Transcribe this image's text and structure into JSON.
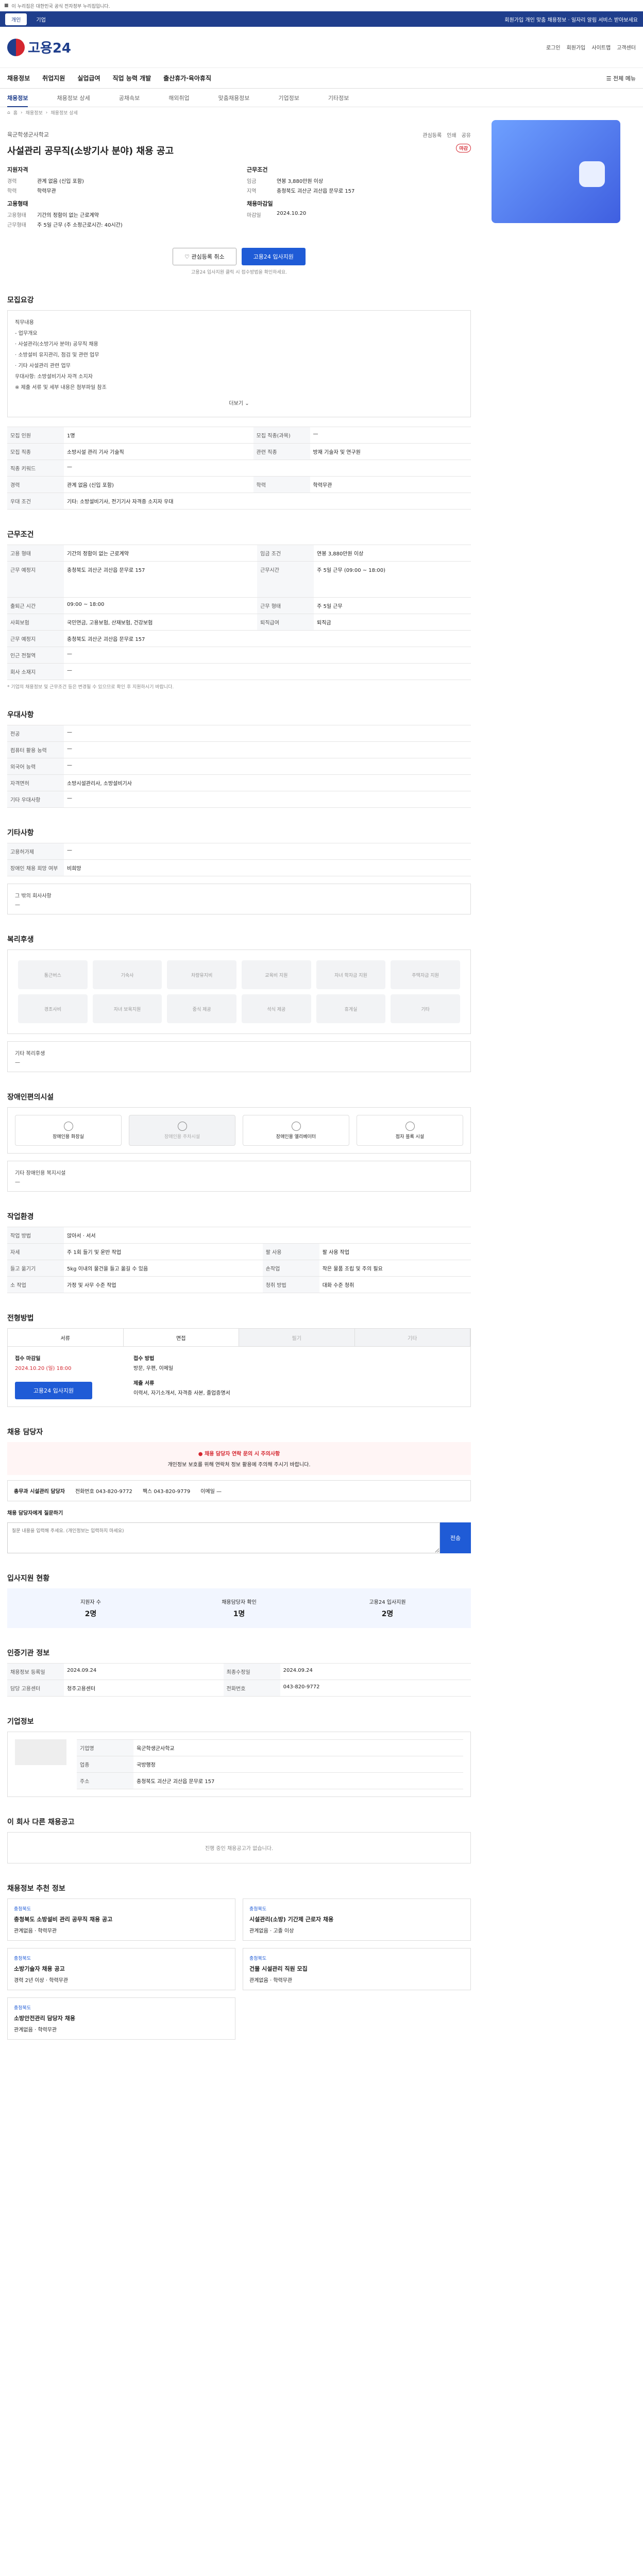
{
  "topbar": {
    "text": "이 누리집은 대한민국 공식 전자정부 누리집입니다."
  },
  "bluebar": {
    "tabs": [
      "개인",
      "기업"
    ],
    "notice": "회원가입 개인 맞춤 채용정보 · 일자리 알림 서비스 받아보세요"
  },
  "header": {
    "logo_text": "고용24",
    "util": [
      "로그인",
      "회원가입",
      "사이트맵",
      "고객센터"
    ]
  },
  "gnb": {
    "items": [
      "채용정보",
      "취업지원",
      "실업급여",
      "직업 능력 개발",
      "출산휴가·육아휴직"
    ],
    "menu_label": "전체 메뉴"
  },
  "subtabs": [
    "채용정보",
    "채용정보 상세",
    "공채속보",
    "해외취업",
    "맞춤채용정보",
    "기업정보",
    "기타정보"
  ],
  "breadcrumb": [
    "홈",
    "채용정보",
    "채용정보 상세"
  ],
  "company": {
    "name": "육군학생군사학교",
    "actions": [
      "관심등록",
      "인쇄",
      "공유"
    ],
    "title": "사설관리 공무직(소방기사 분야) 채용 공고",
    "dday": "마감"
  },
  "summary": {
    "qual_title": "지원자격",
    "qual": [
      [
        "경력",
        "관계 없음 (신입 포함)"
      ],
      [
        "학력",
        "학력무관"
      ]
    ],
    "cond_title": "근무조건",
    "cond": [
      [
        "임금",
        "연봉 3,880만원 이상"
      ],
      [
        "지역",
        "충청북도 괴산군 괴산읍 문무로 157"
      ]
    ],
    "type_title": "고용형태",
    "type": [
      [
        "고용형태",
        "기간의 정함이 없는 근로계약"
      ],
      [
        "근무형태",
        "주 5일 근무 (주 소정근로시간: 40시간)"
      ]
    ],
    "deadline_title": "채용마감일",
    "deadline": [
      [
        "마감일",
        "2024.10.20"
      ]
    ]
  },
  "actions": {
    "cancel": "관심등록 취소",
    "apply": "고용24 입사지원"
  },
  "action_note": "고용24 입사지원 클릭 시 접수방법을 확인하세요.",
  "recruit": {
    "title": "모집요강",
    "content": [
      "직무내용",
      "- 업무개요",
      "· 사설관리(소방기사 분야) 공무직 채용",
      "· 소방설비 유지관리, 점검 및 관련 업무",
      "· 기타 사설관리 관련 업무",
      "우대사항: 소방설비기사 자격 소지자",
      "※ 제출 서류 및 세부 내용은 첨부파일 참조"
    ],
    "more": "더보기",
    "rows": [
      [
        "모집 인원",
        "1명",
        "모집 직종(과목)",
        "—"
      ],
      [
        "모집 직종",
        "소방시설 관리 기사 기술직",
        "관련 직종",
        "방재 기술자 및 연구원"
      ],
      [
        "직종 키워드",
        "—",
        "",
        ""
      ],
      [
        "경력",
        "관계 없음 (신입 포함)",
        "학력",
        "학력무관"
      ],
      [
        "우대 조건",
        "기타: 소방설비기사, 전기기사 자격증 소지자 우대",
        "",
        ""
      ]
    ]
  },
  "conditions": {
    "title": "근무조건",
    "rows": [
      [
        "고용 형태",
        "기간의 정함이 없는 근로계약",
        "임금 조건",
        "연봉 3,880만원 이상"
      ],
      [
        "근무 예정지",
        "충청북도 괴산군 괴산읍 문무로 157",
        "근무시간",
        "주 5일 근무 (09:00 ~ 18:00)"
      ],
      [
        "출퇴근 시간",
        "09:00 ~ 18:00",
        "근무 형태",
        "주 5일 근무"
      ],
      [
        "사회보험",
        "국민연금, 고용보험, 산재보험, 건강보험",
        "퇴직급여",
        "퇴직금"
      ],
      [
        "근무 예정지",
        "충청북도 괴산군 괴산읍 문무로 157",
        "",
        ""
      ],
      [
        "인근 전철역",
        "—",
        "",
        ""
      ],
      [
        "회사 소재지",
        "—",
        "",
        ""
      ]
    ],
    "note": "* 기업의 채용정보 및 근무조건 등은 변경될 수 있으므로 확인 후 지원하시기 바랍니다."
  },
  "extra": {
    "title": "우대사항",
    "rows": [
      [
        "전공",
        "—"
      ],
      [
        "컴퓨터 활용 능력",
        "—"
      ],
      [
        "외국어 능력",
        "—"
      ],
      [
        "자격면허",
        "소방시설관리사, 소방설비기사"
      ],
      [
        "기타 우대사항",
        "—"
      ]
    ]
  },
  "other": {
    "title": "기타사항",
    "rows": [
      [
        "고용허가제",
        "—"
      ],
      [
        "장애인 채용 희망 여부",
        "비희망"
      ]
    ],
    "box_title": "그 밖의 회사사항",
    "box_text": "—"
  },
  "welfare": {
    "title": "복리후생",
    "items": [
      "통근버스",
      "기숙사",
      "차량유지비",
      "교육비 지원",
      "자녀 학자금 지원",
      "주택자금 지원",
      "경조사비",
      "자녀 보육지원",
      "중식 제공",
      "석식 제공",
      "휴게실",
      "기타"
    ],
    "box_title": "기타 복리후생",
    "box_text": "—"
  },
  "facility": {
    "title": "장애인편의시설",
    "items": [
      {
        "label": "장애인용 화장실",
        "off": false
      },
      {
        "label": "장애인용 주차시설",
        "off": true
      },
      {
        "label": "장애인용 엘리베이터",
        "off": false
      },
      {
        "label": "점자 블록 시설",
        "off": false
      }
    ],
    "box_title": "기타 장애인용 복지시설",
    "box_text": "—"
  },
  "workplace": {
    "title": "작업환경",
    "rows": [
      [
        "작업 방법",
        "앉아서 · 서서",
        "",
        ""
      ],
      [
        "자세",
        "주 1회 들기 및 운반 작업",
        "팔 사용",
        "팔 사용 작업"
      ],
      [
        "들고 옮기기",
        "5kg 이내의 물건을 들고 옮길 수 있음",
        "손작업",
        "작은 물품 조립 및 주의 필요"
      ],
      [
        "소 작업",
        "가정 및 사무 수준 작업",
        "청취 방법",
        "대화 수준 청취"
      ]
    ]
  },
  "process": {
    "title": "전형방법",
    "steps": [
      {
        "label": "서류",
        "off": false
      },
      {
        "label": "면접",
        "off": false
      },
      {
        "label": "필기",
        "off": true
      },
      {
        "label": "기타",
        "off": true
      }
    ],
    "deadline_label": "접수 마감일",
    "deadline": "2024.10.20 (일) 18:00",
    "method_label": "접수 방법",
    "method": "방문, 우편, 이메일",
    "docs_label": "제출 서류",
    "docs": "이력서, 자기소개서, 자격증 사본, 졸업증명서",
    "apply_button": "고용24 입사지원"
  },
  "manager": {
    "title": "채용 담당자",
    "alert_title": "채용 담당자 연락 문의 시 주의사항",
    "alert_text": "개인정보 보호를 위해 연락처 정보 활용에 주의해 주시기 바랍니다.",
    "name": "총무과 시설관리 담당자",
    "phone_label": "전화번호",
    "phone": "043-820-9772",
    "fax_label": "팩스",
    "fax": "043-820-9779",
    "email_label": "이메일",
    "email": "—",
    "inquiry_label": "채용 담당자에게 질문하기",
    "inquiry_placeholder": "질문 내용을 입력해 주세요. (개인정보는 입력하지 마세요)",
    "send": "전송"
  },
  "stats": {
    "title": "입사지원 현황",
    "items": [
      [
        "지원자 수",
        "2명"
      ],
      [
        "채용담당자 확인",
        "1명"
      ],
      [
        "고용24 입사지원",
        "2명"
      ]
    ]
  },
  "reginfo": {
    "title": "인증기관 정보",
    "rows": [
      [
        "채용정보 등록일",
        "2024.09.24",
        "최종수정일",
        "2024.09.24"
      ],
      [
        "담당 고용센터",
        "청주고용센터",
        "전화번호",
        "043-820-9772"
      ]
    ]
  },
  "company_info": {
    "title": "기업정보",
    "rows": [
      [
        "기업명",
        "육군학생군사학교"
      ],
      [
        "업종",
        "국방행정"
      ],
      [
        "주소",
        "충청북도 괴산군 괴산읍 문무로 157"
      ]
    ]
  },
  "similar": {
    "title": "이 회사 다른 채용공고",
    "empty": "진행 중인 채용공고가 없습니다."
  },
  "recommend": {
    "title": "채용정보 추천 정보",
    "cards": [
      {
        "tag": "충청북도",
        "title": "충청북도 소방설비 관리 공무직 채용 공고",
        "meta": "관계없음 · 학력무관"
      },
      {
        "tag": "충청북도",
        "title": "시설관리(소방) 기간제 근로자 채용",
        "meta": "관계없음 · 고졸 이상"
      },
      {
        "tag": "충청북도",
        "title": "소방기술자 채용 공고",
        "meta": "경력 2년 이상 · 학력무관"
      },
      {
        "tag": "충청북도",
        "title": "건물 시설관리 직원 모집",
        "meta": "관계없음 · 학력무관"
      },
      {
        "tag": "충청북도",
        "title": "소방안전관리 담당자 채용",
        "meta": "관계없음 · 학력무관"
      }
    ]
  }
}
